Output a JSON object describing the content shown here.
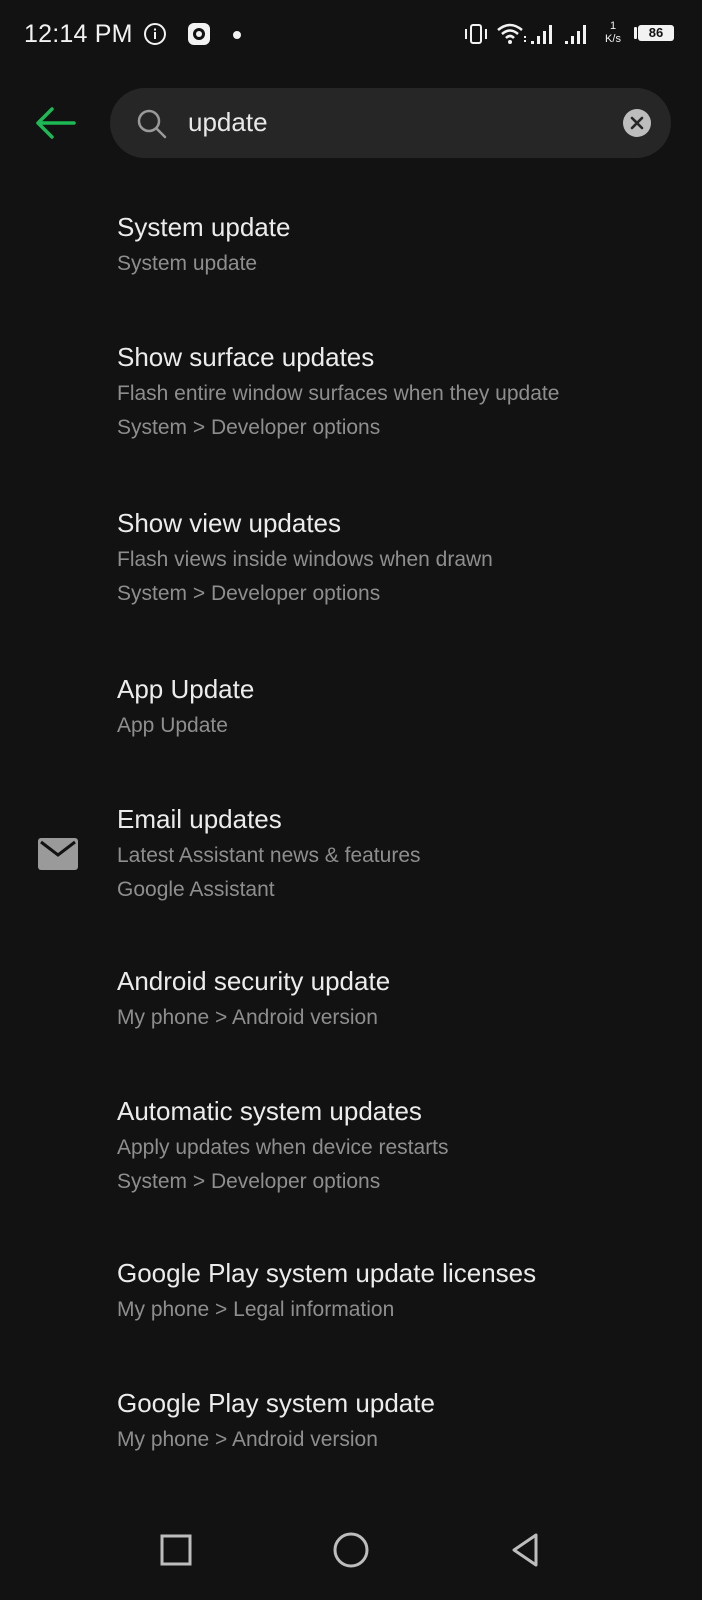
{
  "status_bar": {
    "time": "12:14 PM",
    "net_speed_value": "1",
    "net_speed_unit": "K/s",
    "battery": "86",
    "icons": [
      "info-icon",
      "app-notification-icon",
      "dot-icon",
      "vibrate-icon",
      "wifi-icon",
      "signal-icon",
      "signal-icon"
    ]
  },
  "search": {
    "query": "update",
    "back_icon": "arrow-left-icon",
    "search_icon": "search-icon",
    "clear_icon": "clear-icon"
  },
  "colors": {
    "accent": "#1db954",
    "background": "#121212",
    "search_bg": "#262626",
    "title": "#ececec",
    "subtitle": "#8e8e8e"
  },
  "results": [
    {
      "title": "System update",
      "lines": [
        "System update"
      ]
    },
    {
      "title": "Show surface updates",
      "lines": [
        "Flash entire window surfaces when they update",
        "System > Developer options"
      ]
    },
    {
      "title": "Show view updates",
      "lines": [
        "Flash views inside windows when drawn",
        "System > Developer options"
      ]
    },
    {
      "title": "App Update",
      "lines": [
        "App Update"
      ]
    },
    {
      "title": "Email updates",
      "lines": [
        "Latest Assistant news & features",
        "Google Assistant"
      ],
      "icon": "mail-icon"
    },
    {
      "title": "Android security update",
      "lines": [
        "My phone > Android version"
      ]
    },
    {
      "title": "Automatic system updates",
      "lines": [
        "Apply updates when device restarts",
        "System > Developer options"
      ]
    },
    {
      "title": "Google Play system update licenses",
      "lines": [
        "My phone > Legal information"
      ]
    },
    {
      "title": "Google Play system update",
      "lines": [
        "My phone > Android version"
      ]
    }
  ],
  "nav": [
    "recents-icon",
    "home-icon",
    "back-icon"
  ]
}
